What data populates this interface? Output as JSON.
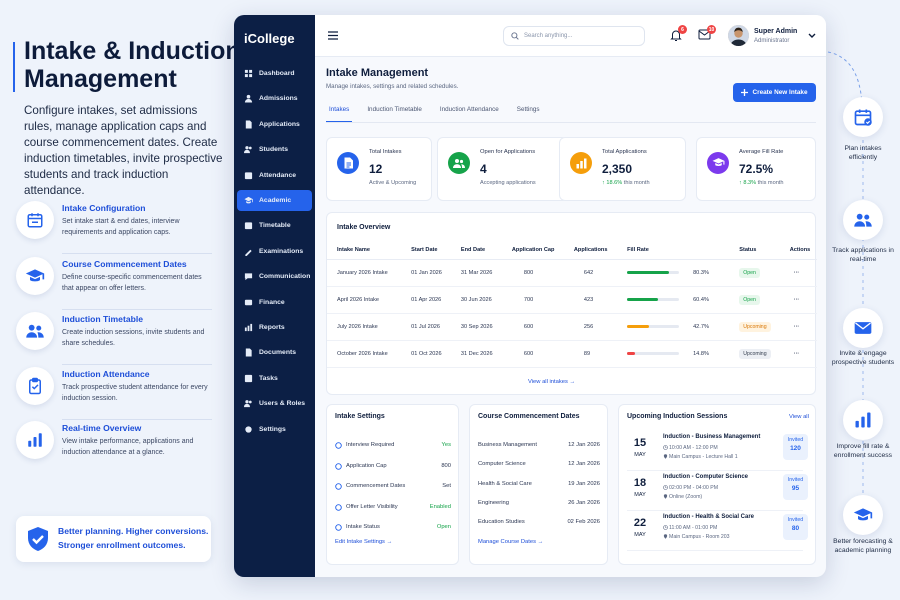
{
  "promo": {
    "title_line1": "Intake & Induction",
    "title_line2": "Management",
    "description": "Configure intakes, set admissions rules, manage application caps and course commencement dates. Create induction timetables, invite prospective students and track induction attendance.",
    "features": [
      {
        "icon": "calendar-icon",
        "title": "Intake Configuration",
        "desc": "Set intake start & end dates, interview requirements and application caps."
      },
      {
        "icon": "graduation-cap-icon",
        "title": "Course Commencement Dates",
        "desc": "Define course-specific commencement dates that appear on offer letters."
      },
      {
        "icon": "users-icon",
        "title": "Induction Timetable",
        "desc": "Create induction sessions, invite students and share schedules."
      },
      {
        "icon": "clipboard-check-icon",
        "title": "Induction Attendance",
        "desc": "Track prospective student attendance for every induction session."
      },
      {
        "icon": "bar-chart-icon",
        "title": "Real-time Overview",
        "desc": "View intake performance, applications and induction attendance at a glance."
      }
    ],
    "bottom_line1": "Better planning. Higher conversions.",
    "bottom_line2": "Stronger enrollment outcomes."
  },
  "app": {
    "logo": "iCollege",
    "nav": [
      {
        "icon": "dashboard-icon",
        "label": "Dashboard",
        "active": false
      },
      {
        "icon": "admissions-icon",
        "label": "Admissions",
        "active": false
      },
      {
        "icon": "applications-icon",
        "label": "Applications",
        "active": false
      },
      {
        "icon": "students-icon",
        "label": "Students",
        "active": false
      },
      {
        "icon": "attendance-icon",
        "label": "Attendance",
        "active": false
      },
      {
        "icon": "academic-icon",
        "label": "Academic",
        "active": true
      },
      {
        "icon": "timetable-icon",
        "label": "Timetable",
        "active": false
      },
      {
        "icon": "examinations-icon",
        "label": "Examinations",
        "active": false
      },
      {
        "icon": "communication-icon",
        "label": "Communication",
        "active": false
      },
      {
        "icon": "finance-icon",
        "label": "Finance",
        "active": false
      },
      {
        "icon": "reports-icon",
        "label": "Reports",
        "active": false
      },
      {
        "icon": "documents-icon",
        "label": "Documents",
        "active": false
      },
      {
        "icon": "tasks-icon",
        "label": "Tasks",
        "active": false
      },
      {
        "icon": "users-roles-icon",
        "label": "Users & Roles",
        "active": false
      },
      {
        "icon": "settings-icon",
        "label": "Settings",
        "active": false
      }
    ],
    "search_placeholder": "Search anything...",
    "notifications_count": "6",
    "messages_count": "10",
    "user_name": "Super Admin",
    "user_role": "Administrator",
    "page_title": "Intake Management",
    "page_subtitle": "Manage intakes, settings and related schedules.",
    "create_button": "Create New Intake",
    "tabs": [
      "Intakes",
      "Induction Timetable",
      "Induction Attendance",
      "Settings"
    ],
    "active_tab": 0,
    "kpis": [
      {
        "icon": "document-icon",
        "color": "#2563eb",
        "label": "Total Intakes",
        "value": "12",
        "sub": "Active & Upcoming",
        "delta": ""
      },
      {
        "icon": "users-icon",
        "color": "#16a34a",
        "label": "Open for Applications",
        "value": "4",
        "sub": "Accepting applications",
        "delta": ""
      },
      {
        "icon": "bar-chart-icon",
        "color": "#f59e0b",
        "label": "Total Applications",
        "value": "2,350",
        "sub": "this month",
        "delta": "↑ 18.6%"
      },
      {
        "icon": "graduation-cap-icon",
        "color": "#7c3aed",
        "label": "Average Fill Rate",
        "value": "72.5%",
        "sub": "this month",
        "delta": "↑ 8.3%"
      }
    ],
    "overview": {
      "title": "Intake Overview",
      "columns": [
        "Intake Name",
        "Start Date",
        "End Date",
        "Application Cap",
        "Applications",
        "Fill Rate",
        "Status",
        "Actions"
      ],
      "rows": [
        {
          "name": "January 2026 Intake",
          "start": "01 Jan 2026",
          "end": "31 Mar 2026",
          "cap": "800",
          "apps": "642",
          "fill": 80.3,
          "fill_label": "80.3%",
          "fill_color": "#16a34a",
          "status": "Open",
          "status_bg": "#e7f7ec",
          "status_fg": "#16a34a"
        },
        {
          "name": "April 2026 Intake",
          "start": "01 Apr 2026",
          "end": "30 Jun 2026",
          "cap": "700",
          "apps": "423",
          "fill": 60.4,
          "fill_label": "60.4%",
          "fill_color": "#16a34a",
          "status": "Open",
          "status_bg": "#e7f7ec",
          "status_fg": "#16a34a"
        },
        {
          "name": "July 2026 Intake",
          "start": "01 Jul 2026",
          "end": "30 Sep 2026",
          "cap": "600",
          "apps": "256",
          "fill": 42.7,
          "fill_label": "42.7%",
          "fill_color": "#f59e0b",
          "status": "Upcoming",
          "status_bg": "#fff3df",
          "status_fg": "#d97706"
        },
        {
          "name": "October 2026 Intake",
          "start": "01 Oct 2026",
          "end": "31 Dec 2026",
          "cap": "600",
          "apps": "89",
          "fill": 14.8,
          "fill_label": "14.8%",
          "fill_color": "#ef4444",
          "status": "Upcoming",
          "status_bg": "#eceff4",
          "status_fg": "#374151"
        }
      ],
      "actions_glyph": "···",
      "view_all": "View all intakes"
    },
    "intake_settings": {
      "title": "Intake Settings",
      "rows": [
        {
          "icon": "interview-icon",
          "label": "Interview Required",
          "value": "Yes",
          "color": "#16a34a"
        },
        {
          "icon": "cap-icon",
          "label": "Application Cap",
          "value": "800",
          "color": "#2b3652"
        },
        {
          "icon": "commencement-icon",
          "label": "Commencement Dates",
          "value": "Set",
          "color": "#2b3652"
        },
        {
          "icon": "offer-letter-icon",
          "label": "Offer Letter Visibility",
          "value": "Enabled",
          "color": "#16a34a"
        },
        {
          "icon": "status-icon",
          "label": "Intake Status",
          "value": "Open",
          "color": "#16a34a"
        }
      ],
      "link": "Edit Intake Settings"
    },
    "commencement": {
      "title": "Course Commencement Dates",
      "rows": [
        {
          "course": "Business Management",
          "date": "12 Jan 2026"
        },
        {
          "course": "Computer Science",
          "date": "12 Jan 2026"
        },
        {
          "course": "Health & Social Care",
          "date": "19 Jan 2026"
        },
        {
          "course": "Engineering",
          "date": "26 Jan 2026"
        },
        {
          "course": "Education Studies",
          "date": "02 Feb 2026"
        }
      ],
      "link": "Manage Course Dates"
    },
    "sessions": {
      "title": "Upcoming Induction Sessions",
      "view_all": "View all",
      "rows": [
        {
          "day": "15",
          "month": "MAY",
          "name": "Induction - Business Management",
          "time": "10:00 AM - 12:00 PM",
          "location": "Main Campus - Lecture Hall 1",
          "invited_label": "Invited",
          "invited": "120"
        },
        {
          "day": "18",
          "month": "MAY",
          "name": "Induction - Computer Science",
          "time": "02:00 PM - 04:00 PM",
          "location": "Online (Zoom)",
          "invited_label": "Invited",
          "invited": "95"
        },
        {
          "day": "22",
          "month": "MAY",
          "name": "Induction - Health & Social Care",
          "time": "11:00 AM - 01:00 PM",
          "location": "Main Campus - Room 203",
          "invited_label": "Invited",
          "invited": "80"
        }
      ]
    }
  },
  "rail": [
    {
      "icon": "calendar-check-icon",
      "text": "Plan intakes efficiently"
    },
    {
      "icon": "users-icon",
      "text": "Track applications in real-time"
    },
    {
      "icon": "mail-icon",
      "text": "Invite & engage prospective students"
    },
    {
      "icon": "bar-chart-icon",
      "text": "Improve fill rate & enrollment success"
    },
    {
      "icon": "graduation-cap-icon",
      "text": "Better forecasting & academic planning"
    }
  ]
}
